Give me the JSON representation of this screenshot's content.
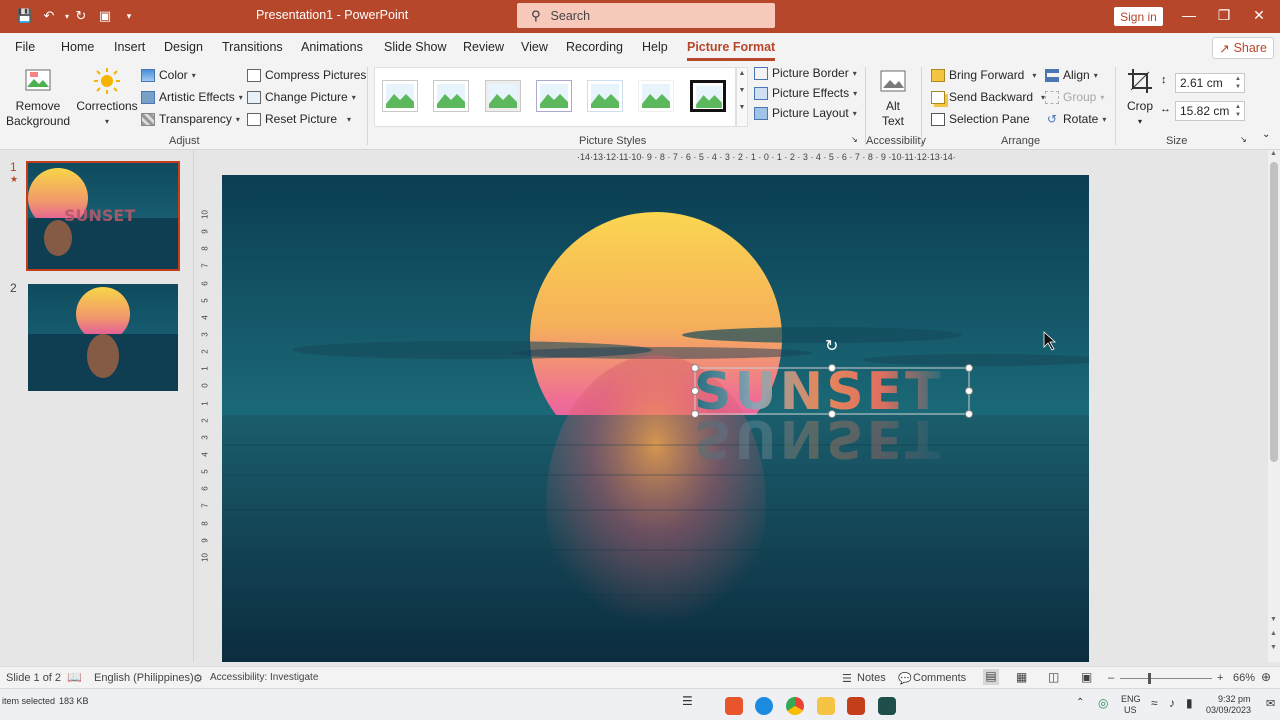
{
  "titlebar": {
    "title": "Presentation1  -  PowerPoint",
    "search_placeholder": "Search",
    "signin_label": "Sign in"
  },
  "tabs": [
    {
      "label": "File"
    },
    {
      "label": "Home"
    },
    {
      "label": "Insert"
    },
    {
      "label": "Design"
    },
    {
      "label": "Transitions"
    },
    {
      "label": "Animations"
    },
    {
      "label": "Slide Show"
    },
    {
      "label": "Review"
    },
    {
      "label": "View"
    },
    {
      "label": "Recording"
    },
    {
      "label": "Help"
    },
    {
      "label": "Picture Format"
    }
  ],
  "share_label": "Share",
  "ribbon": {
    "adjust": {
      "remove_bg_line1": "Remove",
      "remove_bg_line2": "Background",
      "corrections": "Corrections",
      "color": "Color",
      "artistic": "Artistic Effects",
      "transparency": "Transparency",
      "compress": "Compress Pictures",
      "change": "Change Picture",
      "reset": "Reset Picture",
      "label": "Adjust"
    },
    "styles": {
      "border": "Picture Border",
      "effects": "Picture Effects",
      "layout": "Picture Layout",
      "label": "Picture Styles"
    },
    "accessibility": {
      "alt_line1": "Alt",
      "alt_line2": "Text",
      "label": "Accessibility"
    },
    "arrange": {
      "bring_forward": "Bring Forward",
      "send_backward": "Send Backward",
      "selection_pane": "Selection Pane",
      "align": "Align",
      "group": "Group",
      "rotate": "Rotate",
      "label": "Arrange"
    },
    "size": {
      "crop": "Crop",
      "height": "2.61 cm",
      "width": "15.82 cm",
      "label": "Size"
    }
  },
  "slides": [
    {
      "number": "1",
      "text": "SUNSET"
    },
    {
      "number": "2"
    }
  ],
  "ruler": {
    "horizontal": "·14·13·12·11·10· 9 · 8 · 7 · 6 · 5 · 4 · 3 · 2 · 1 · 0 · 1 · 2 · 3 · 4 · 5 · 6 · 7 · 8 · 9 ·10·11·12·13·14·",
    "vertical": [
      "10",
      "9",
      "8",
      "7",
      "6",
      "5",
      "4",
      "3",
      "2",
      "1",
      "0",
      "1",
      "2",
      "3",
      "4",
      "5",
      "6",
      "7",
      "8",
      "9",
      "10"
    ]
  },
  "slide_text": "SUNSET",
  "statusbar": {
    "slide_info": "Slide 1 of 2",
    "language": "English (Philippines)",
    "accessibility": "Accessibility: Investigate",
    "notes": "Notes",
    "comments": "Comments",
    "zoom": "66%"
  },
  "taskbar": {
    "item_selected": "item selected",
    "size": "183 KB",
    "lang_line1": "ENG",
    "lang_line2": "US",
    "time": "9:32 pm",
    "date": "03/09/2023"
  },
  "colors": {
    "accent": "#b7472a",
    "ribbon_bg": "#f3f3f3"
  }
}
